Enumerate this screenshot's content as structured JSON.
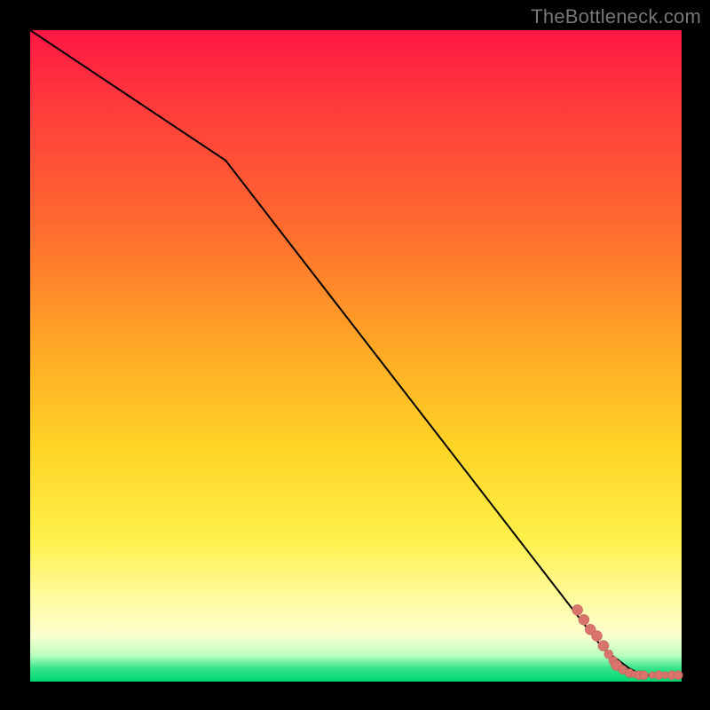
{
  "watermark": "TheBottleneck.com",
  "colors": {
    "line": "#000000",
    "marker_fill": "#d9746c",
    "marker_stroke": "#b85a52"
  },
  "chart_data": {
    "type": "line",
    "title": "",
    "xlabel": "",
    "ylabel": "",
    "xlim": [
      0,
      100
    ],
    "ylim": [
      0,
      100
    ],
    "series": [
      {
        "name": "curve",
        "x": [
          0,
          30,
          88,
          92,
          94,
          100
        ],
        "values": [
          100,
          80,
          5,
          2,
          1,
          1
        ]
      }
    ],
    "markers": {
      "name": "data-points",
      "points": [
        {
          "x": 84.0,
          "y": 11.0,
          "r": 6
        },
        {
          "x": 85.0,
          "y": 9.5,
          "r": 6
        },
        {
          "x": 86.0,
          "y": 8.0,
          "r": 6
        },
        {
          "x": 87.0,
          "y": 7.0,
          "r": 6
        },
        {
          "x": 88.0,
          "y": 5.5,
          "r": 6
        },
        {
          "x": 88.8,
          "y": 4.2,
          "r": 5
        },
        {
          "x": 89.5,
          "y": 3.2,
          "r": 5
        },
        {
          "x": 90.0,
          "y": 2.5,
          "r": 6
        },
        {
          "x": 91.0,
          "y": 1.8,
          "r": 5
        },
        {
          "x": 92.0,
          "y": 1.3,
          "r": 5
        },
        {
          "x": 92.8,
          "y": 1.1,
          "r": 4
        },
        {
          "x": 93.5,
          "y": 1.0,
          "r": 5
        },
        {
          "x": 94.2,
          "y": 1.0,
          "r": 5
        },
        {
          "x": 95.5,
          "y": 1.0,
          "r": 4
        },
        {
          "x": 96.5,
          "y": 1.0,
          "r": 5
        },
        {
          "x": 97.5,
          "y": 1.0,
          "r": 4
        },
        {
          "x": 98.5,
          "y": 1.0,
          "r": 5
        },
        {
          "x": 99.5,
          "y": 1.0,
          "r": 5
        }
      ]
    }
  }
}
